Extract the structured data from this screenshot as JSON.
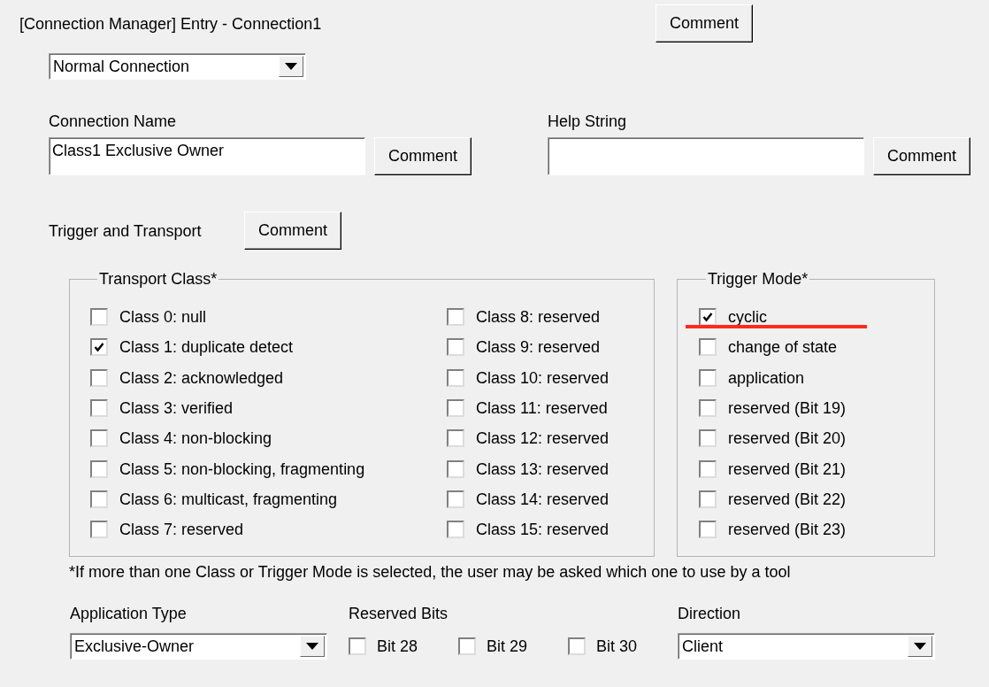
{
  "window": {
    "title": "[Connection Manager] Entry - Connection1",
    "comment": "Comment"
  },
  "connection_type": {
    "value": "Normal Connection"
  },
  "connection_name": {
    "label": "Connection Name",
    "value": "Class1 Exclusive Owner",
    "comment": "Comment"
  },
  "help_string": {
    "label": "Help String",
    "comment": "Comment"
  },
  "trigger_and_transport": {
    "label": "Trigger and Transport",
    "comment": "Comment"
  },
  "transport_class": {
    "title": "Transport Class*",
    "options": [
      {
        "label": "Class 0: null",
        "checked": false
      },
      {
        "label": "Class 1: duplicate detect",
        "checked": true
      },
      {
        "label": "Class 2: acknowledged",
        "checked": false
      },
      {
        "label": "Class 3: verified",
        "checked": false
      },
      {
        "label": "Class 4: non-blocking",
        "checked": false
      },
      {
        "label": "Class 5: non-blocking, fragmenting",
        "checked": false
      },
      {
        "label": "Class 6: multicast, fragmenting",
        "checked": false
      },
      {
        "label": "Class 7: reserved",
        "checked": false
      },
      {
        "label": "Class 8: reserved",
        "checked": false
      },
      {
        "label": "Class 9: reserved",
        "checked": false
      },
      {
        "label": "Class 10: reserved",
        "checked": false
      },
      {
        "label": "Class 11: reserved",
        "checked": false
      },
      {
        "label": "Class 12: reserved",
        "checked": false
      },
      {
        "label": "Class 13: reserved",
        "checked": false
      },
      {
        "label": "Class 14: reserved",
        "checked": false
      },
      {
        "label": "Class 15: reserved",
        "checked": false
      }
    ]
  },
  "trigger_mode": {
    "title": "Trigger Mode*",
    "options": [
      {
        "label": "cyclic",
        "checked": true
      },
      {
        "label": "change of state",
        "checked": false
      },
      {
        "label": "application",
        "checked": false
      },
      {
        "label": "reserved (Bit 19)",
        "checked": false
      },
      {
        "label": "reserved (Bit 20)",
        "checked": false
      },
      {
        "label": "reserved (Bit 21)",
        "checked": false
      },
      {
        "label": "reserved (Bit 22)",
        "checked": false
      },
      {
        "label": "reserved (Bit 23)",
        "checked": false
      }
    ]
  },
  "footnote": "*If more than one Class or Trigger Mode is selected, the user may be asked which one to use by a tool",
  "application_type": {
    "label": "Application Type",
    "value": "Exclusive-Owner"
  },
  "reserved_bits": {
    "label": "Reserved Bits",
    "bits": [
      {
        "label": "Bit 28",
        "checked": false
      },
      {
        "label": "Bit 29",
        "checked": false
      },
      {
        "label": "Bit 30",
        "checked": false
      }
    ]
  },
  "direction": {
    "label": "Direction",
    "value": "Client"
  }
}
